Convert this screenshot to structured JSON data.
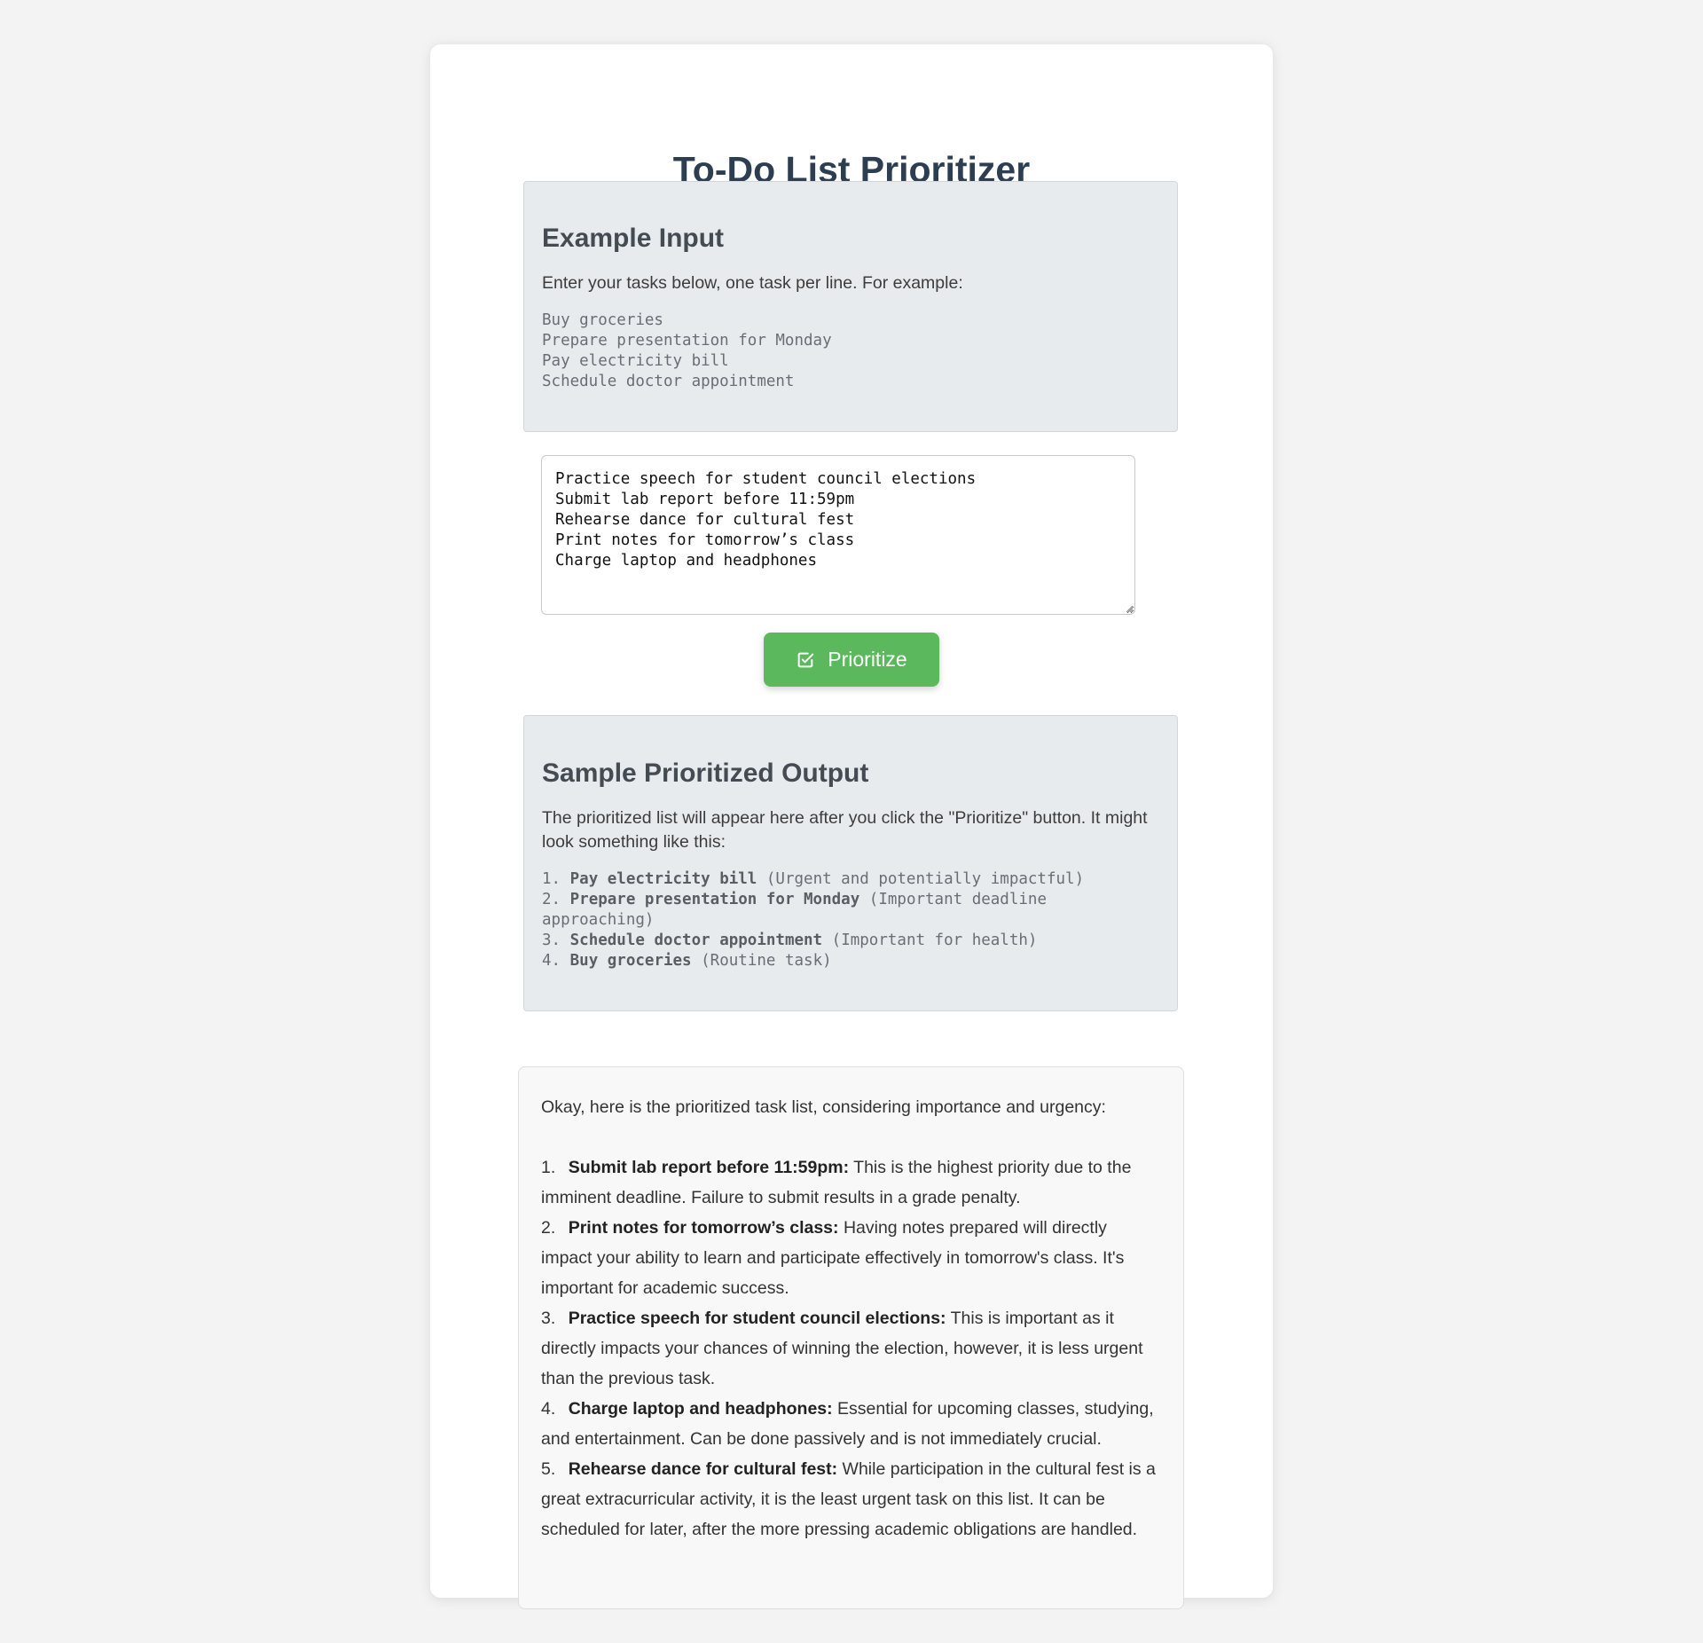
{
  "app": {
    "title": "To-Do List Prioritizer"
  },
  "example": {
    "heading": "Example Input",
    "description": "Enter your tasks below, one task per line. For example:",
    "lines": [
      "Buy groceries",
      "Prepare presentation for Monday",
      "Pay electricity bill",
      "Schedule doctor appointment"
    ]
  },
  "input": {
    "value": "Practice speech for student council elections\nSubmit lab report before 11:59pm\nRehearse dance for cultural fest\nPrint notes for tomorrow’s class\nCharge laptop and headphones"
  },
  "button": {
    "label": "Prioritize",
    "icon": "checkbox-check-icon",
    "color": "#5cb85c"
  },
  "sample": {
    "heading": "Sample Prioritized Output",
    "description": "The prioritized list will appear here after you click the \"Prioritize\" button. It might look something like this:",
    "items": [
      {
        "num": "1.",
        "task": "Pay electricity bill",
        "note": "(Urgent and potentially impactful)"
      },
      {
        "num": "2.",
        "task": "Prepare presentation for Monday",
        "note": "(Important deadline approaching)"
      },
      {
        "num": "3.",
        "task": "Schedule doctor appointment",
        "note": "(Important for health)"
      },
      {
        "num": "4.",
        "task": "Buy groceries",
        "note": "(Routine task)"
      }
    ]
  },
  "result": {
    "intro": "Okay, here is the prioritized task list, considering importance and urgency:",
    "items": [
      {
        "num": "1.",
        "task": "Submit lab report before 11:59pm:",
        "reason": "This is the highest priority due to the imminent deadline. Failure to submit results in a grade penalty."
      },
      {
        "num": "2.",
        "task": "Print notes for tomorrow’s class:",
        "reason": "Having notes prepared will directly impact your ability to learn and participate effectively in tomorrow's class. It's important for academic success."
      },
      {
        "num": "3.",
        "task": "Practice speech for student council elections:",
        "reason": "This is important as it directly impacts your chances of winning the election, however, it is less urgent than the previous task."
      },
      {
        "num": "4.",
        "task": "Charge laptop and headphones:",
        "reason": "Essential for upcoming classes, studying, and entertainment. Can be done passively and is not immediately crucial."
      },
      {
        "num": "5.",
        "task": "Rehearse dance for cultural fest:",
        "reason": "While participation in the cultural fest is a great extracurricular activity, it is the least urgent task on this list. It can be scheduled for later, after the more pressing academic obligations are handled."
      }
    ]
  }
}
